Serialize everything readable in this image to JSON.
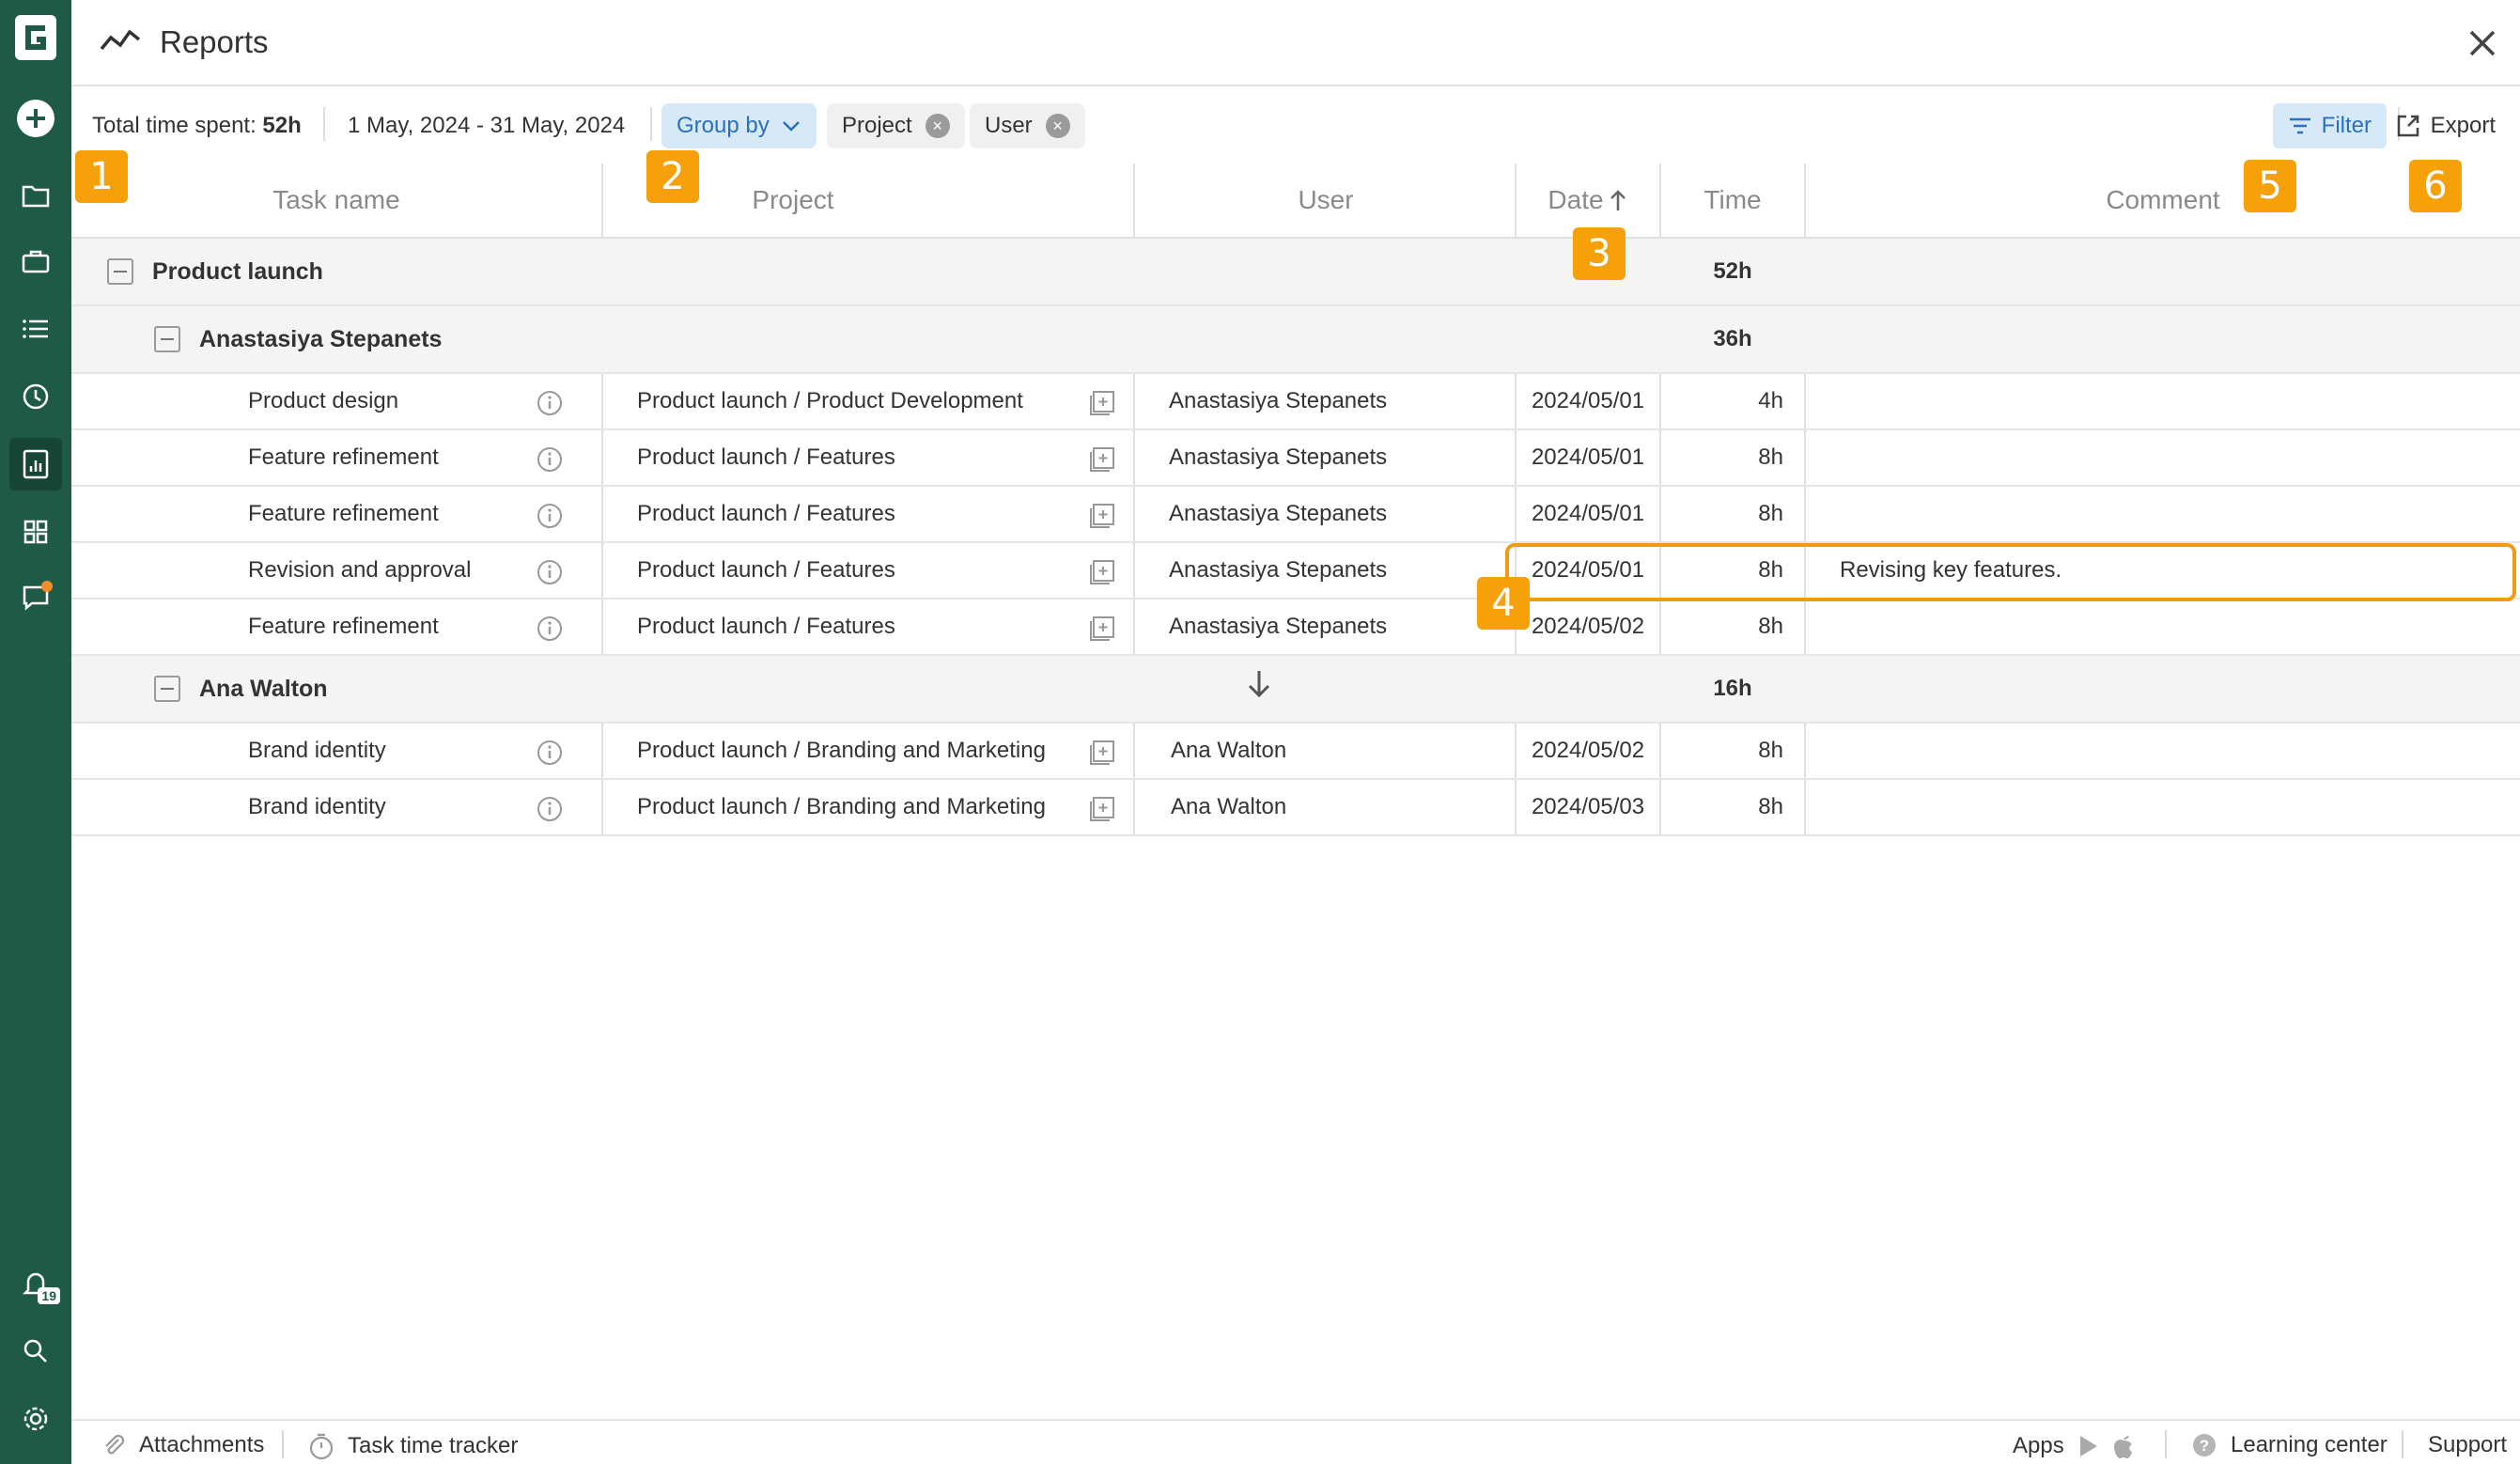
{
  "header": {
    "title": "Reports"
  },
  "toolbar": {
    "total_label": "Total time spent:",
    "total_value": "52h",
    "date_range": "1 May, 2024 - 31 May, 2024",
    "group_by_label": "Group by",
    "chips": [
      "Project",
      "User"
    ],
    "filter_label": "Filter",
    "export_label": "Export"
  },
  "table": {
    "columns": [
      "Task name",
      "Project",
      "User",
      "Date",
      "Time",
      "Comment"
    ],
    "groups": [
      {
        "label": "Product launch",
        "time": "52h"
      },
      {
        "label": "Anastasiya Stepanets",
        "time": "36h"
      },
      {
        "label": "Ana Walton",
        "time": "16h"
      }
    ],
    "rows": [
      {
        "task": "Product design",
        "project": "Product launch / Product Development",
        "user": "Anastasiya Stepanets",
        "date": "2024/05/01",
        "time": "4h",
        "comment": ""
      },
      {
        "task": "Feature refinement",
        "project": "Product launch / Features",
        "user": "Anastasiya Stepanets",
        "date": "2024/05/01",
        "time": "8h",
        "comment": ""
      },
      {
        "task": "Feature refinement",
        "project": "Product launch / Features",
        "user": "Anastasiya Stepanets",
        "date": "2024/05/01",
        "time": "8h",
        "comment": ""
      },
      {
        "task": "Revision and approval",
        "project": "Product launch / Features",
        "user": "Anastasiya Stepanets",
        "date": "2024/05/01",
        "time": "8h",
        "comment": "Revising key features."
      },
      {
        "task": "Feature refinement",
        "project": "Product launch / Features",
        "user": "Anastasiya Stepanets",
        "date": "2024/05/02",
        "time": "8h",
        "comment": ""
      },
      {
        "task": "Brand identity",
        "project": "Product launch / Branding and Marketing",
        "user": "Ana Walton",
        "date": "2024/05/02",
        "time": "8h",
        "comment": ""
      },
      {
        "task": "Brand identity",
        "project": "Product launch / Branding and Marketing",
        "user": "Ana Walton",
        "date": "2024/05/03",
        "time": "8h",
        "comment": ""
      }
    ]
  },
  "markers": [
    "1",
    "2",
    "3",
    "4",
    "5",
    "6"
  ],
  "sidebar": {
    "notification_count": "19"
  },
  "footer": {
    "attachments": "Attachments",
    "tracker": "Task time tracker",
    "apps": "Apps",
    "learning": "Learning center",
    "support": "Support"
  },
  "colors": {
    "sidebar": "#1f5a47",
    "accent": "#2b6fbf",
    "marker": "#f6a00a"
  }
}
